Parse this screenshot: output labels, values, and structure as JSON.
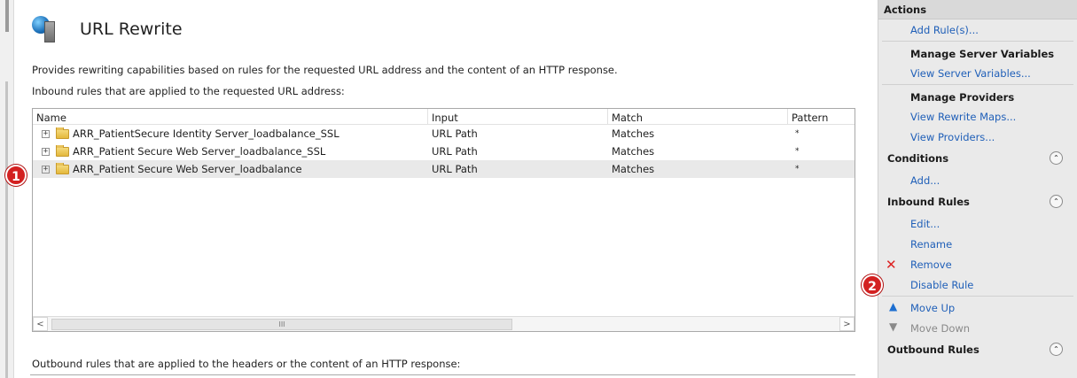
{
  "page": {
    "title": "URL Rewrite",
    "description": "Provides rewriting capabilities based on rules for the requested URL address and the content of an HTTP response.",
    "inbound_caption": "Inbound rules that are applied to the requested URL address:",
    "outbound_caption": "Outbound rules that are applied to the headers or the content of an HTTP response:"
  },
  "grid": {
    "columns": [
      "Name",
      "Input",
      "Match",
      "Pattern"
    ],
    "rows": [
      {
        "name": "ARR_PatientSecure Identity Server_loadbalance_SSL",
        "input": "URL Path",
        "match": "Matches",
        "pattern": "*"
      },
      {
        "name": "ARR_Patient Secure Web Server_loadbalance_SSL",
        "input": "URL Path",
        "match": "Matches",
        "pattern": "*"
      },
      {
        "name": "ARR_Patient Secure Web Server_loadbalance",
        "input": "URL Path",
        "match": "Matches",
        "pattern": "*"
      }
    ],
    "scroll_left": "<",
    "scroll_right": ">",
    "scroll_thumb": "III"
  },
  "badges": {
    "one": "1",
    "two": "2"
  },
  "actions": {
    "header": "Actions",
    "add_rules": "Add Rule(s)...",
    "manage_server_variables": "Manage Server Variables",
    "view_server_variables": "View Server Variables...",
    "manage_providers": "Manage Providers",
    "view_rewrite_maps": "View Rewrite Maps...",
    "view_providers": "View Providers...",
    "conditions_title": "Conditions",
    "conditions_add": "Add...",
    "inbound_title": "Inbound Rules",
    "edit": "Edit...",
    "rename": "Rename",
    "remove": "Remove",
    "disable_rule": "Disable Rule",
    "move_up": "Move Up",
    "move_down": "Move Down",
    "outbound_title": "Outbound Rules"
  }
}
